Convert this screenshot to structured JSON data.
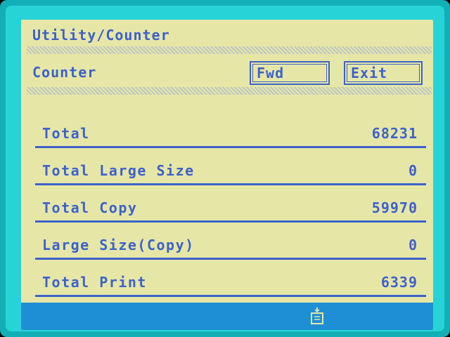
{
  "screen": {
    "title": "Utility/Counter",
    "header_label": "Counter",
    "buttons": {
      "fwd": "Fwd",
      "exit": "Exit"
    }
  },
  "counters": [
    {
      "label": "Total",
      "value": "68231"
    },
    {
      "label": "Total Large Size",
      "value": "0"
    },
    {
      "label": "Total Copy",
      "value": "59970"
    },
    {
      "label": "Large Size(Copy)",
      "value": "0"
    },
    {
      "label": "Total Print",
      "value": "6339"
    }
  ],
  "status": {
    "icon": "document-tray-icon"
  },
  "colors": {
    "screen_bg": "#e6e7a7",
    "text": "#3e61c9",
    "status_bar": "#1f8fd5",
    "bezel": "#27d3d7"
  }
}
